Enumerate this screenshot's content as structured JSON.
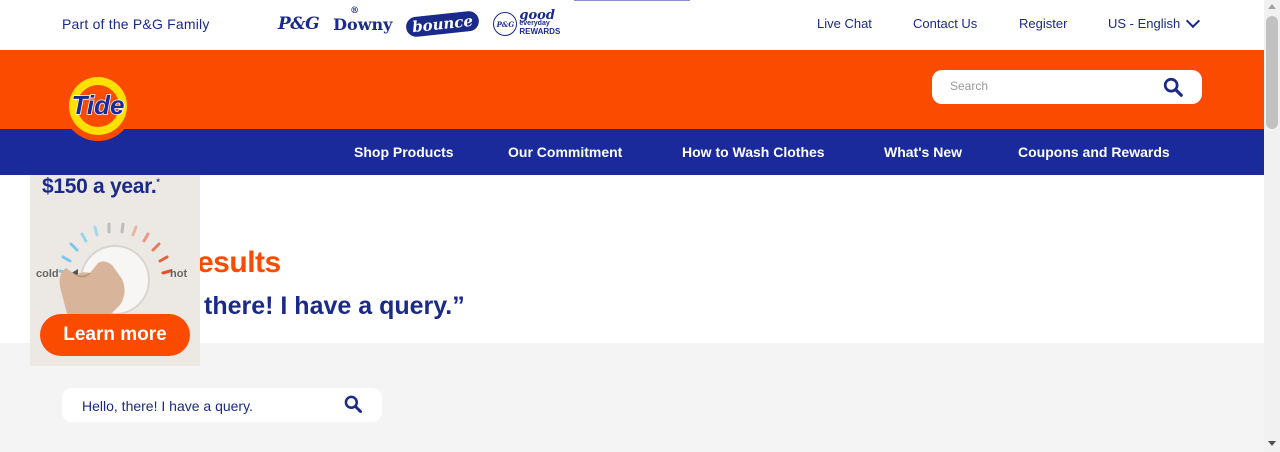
{
  "topbar": {
    "family_text": "Part of the P&G Family",
    "brands": [
      {
        "label": "P&G"
      },
      {
        "label": "Downy",
        "reg": "®"
      },
      {
        "label": "bounce"
      },
      {
        "badge": "P&G",
        "line1": "good",
        "line2": "everyday",
        "line3": "REWARDS"
      }
    ],
    "links": {
      "live_chat": "Live Chat",
      "contact": "Contact Us",
      "register": "Register",
      "language": "US - English"
    }
  },
  "header": {
    "logo_text": "Tide",
    "search": {
      "placeholder": "Search"
    }
  },
  "nav": {
    "items": [
      {
        "label": "Shop Products"
      },
      {
        "label": "Our Commitment"
      },
      {
        "label": "How to Wash Clothes"
      },
      {
        "label": "What's New"
      },
      {
        "label": "Coupons and Rewards"
      }
    ]
  },
  "main": {
    "heading": "esults",
    "query_echo": "there! I have a query.”",
    "search": {
      "value": "Hello, there! I have a query."
    }
  },
  "ad": {
    "headline": "$150 a year.",
    "footnote_mark": "*",
    "cold_label": "cold",
    "hot_label": "hot",
    "cta": "Learn more"
  },
  "colors": {
    "brand_orange": "#fa4b00",
    "brand_blue": "#1a2a9a",
    "text_blue": "#1a2a8a",
    "logo_yellow": "#ffe000"
  }
}
